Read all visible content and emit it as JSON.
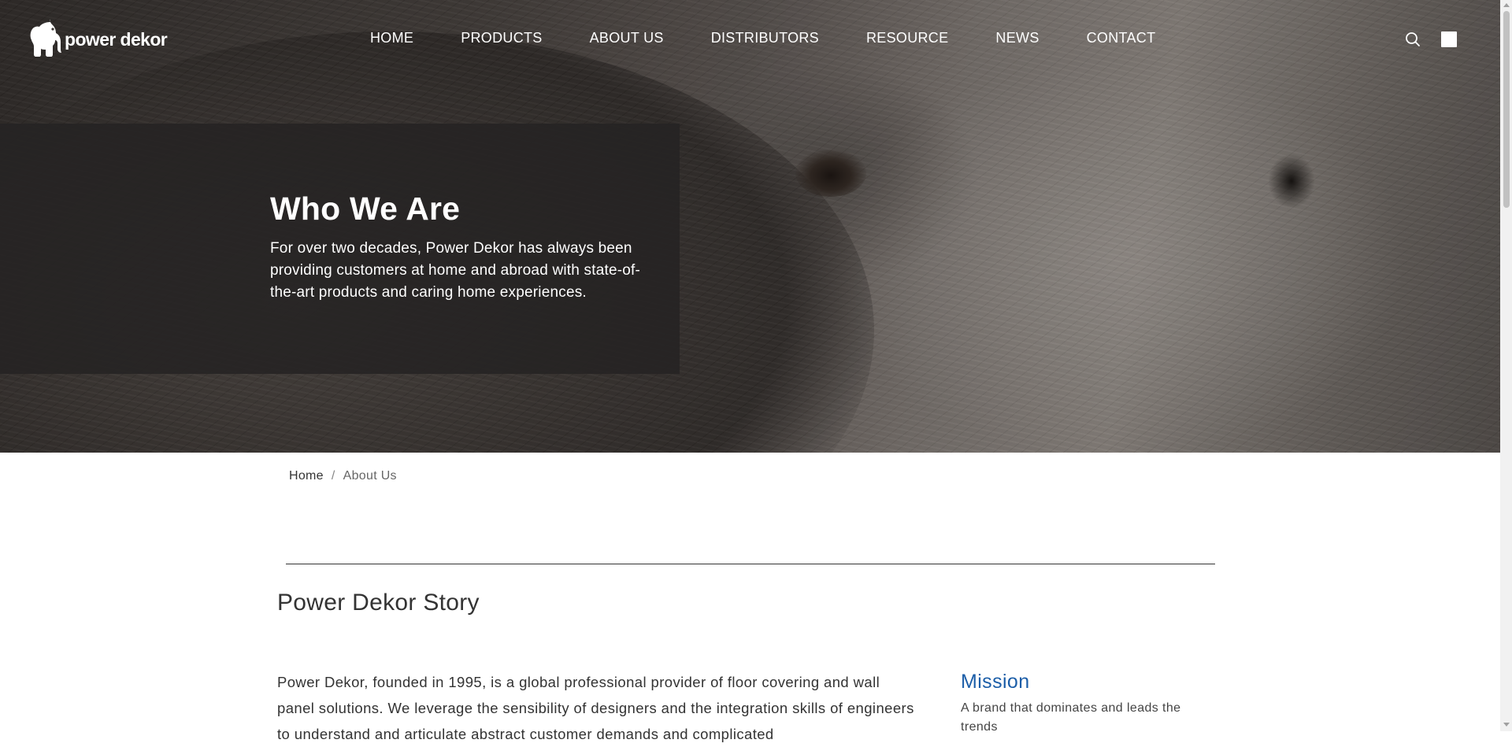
{
  "header": {
    "logo_text": "power dekor",
    "nav": [
      {
        "label": "HOME"
      },
      {
        "label": "PRODUCTS"
      },
      {
        "label": "ABOUT US"
      },
      {
        "label": "DISTRIBUTORS"
      },
      {
        "label": "RESOURCE"
      },
      {
        "label": "NEWS"
      },
      {
        "label": "CONTACT"
      }
    ],
    "icons": {
      "search": "search-icon",
      "language": "language-square-icon"
    }
  },
  "hero": {
    "title": "Who We Are",
    "description": "For over two decades, Power Dekor has always been providing customers at home and abroad with state-of-the-art products and caring home experiences."
  },
  "breadcrumb": {
    "home": "Home",
    "separator": "/",
    "current": "About Us"
  },
  "story": {
    "title": "Power Dekor Story",
    "body": "Power Dekor, founded in 1995, is a global professional provider of floor covering and wall panel solutions. We leverage the sensibility of designers and the integration skills of engineers to understand and articulate abstract customer demands and complicated"
  },
  "mission": {
    "title": "Mission",
    "text": "A brand that dominates and leads the trends"
  },
  "colors": {
    "accent_blue": "#1c5ea8",
    "hero_overlay": "#262423",
    "text_dark": "#333333"
  }
}
